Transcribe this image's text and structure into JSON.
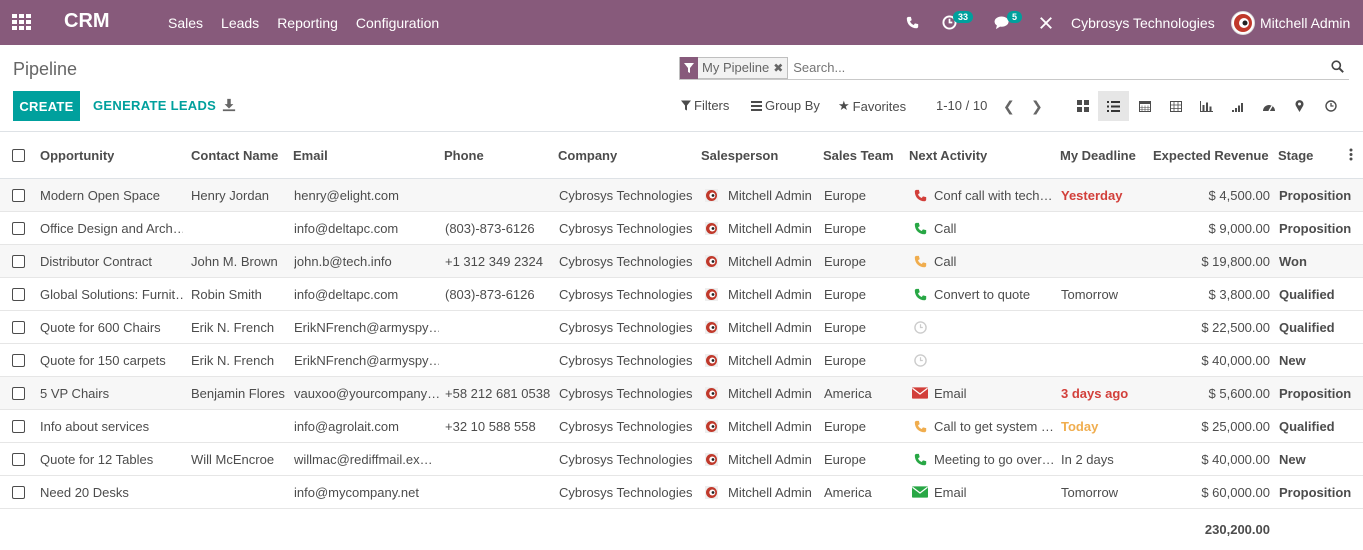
{
  "app": {
    "brand": "CRM",
    "menu": [
      "Sales",
      "Leads",
      "Reporting",
      "Configuration"
    ],
    "activity_count": "33",
    "message_count": "5",
    "company": "Cybrosys Technologies",
    "user": "Mitchell Admin"
  },
  "control": {
    "title": "Pipeline",
    "facet_label": "My Pipeline",
    "search_placeholder": "Search...",
    "create_label": "CREATE",
    "generate_label": "GENERATE LEADS",
    "filters_label": "Filters",
    "groupby_label": "Group By",
    "favorites_label": "Favorites",
    "pager": "1-10 / 10"
  },
  "colors": {
    "navbar": "#875a7b",
    "primary": "#00a09d",
    "danger": "#d23f3a",
    "warning": "#f0ad4e",
    "success": "#28a745",
    "phone_red": "#d23f3a",
    "phone_green": "#28a745",
    "phone_orange": "#f0ad4e"
  },
  "table": {
    "columns": [
      "Opportunity",
      "Contact Name",
      "Email",
      "Phone",
      "Company",
      "Salesperson",
      "Sales Team",
      "Next Activity",
      "My Deadline",
      "Expected Revenue",
      "Stage"
    ],
    "rows": [
      {
        "opportunity": "Modern Open Space",
        "contact": "Henry Jordan",
        "email": "henry@elight.com",
        "phone": "",
        "company": "Cybrosys Technologies",
        "salesperson": "Mitchell Admin",
        "team": "Europe",
        "activity": "Conf call with tech…",
        "activity_icon": "phone-icon",
        "activity_color": "#d23f3a",
        "deadline": "Yesterday",
        "deadline_style": "red",
        "revenue": "$ 4,500.00",
        "stage": "Proposition"
      },
      {
        "opportunity": "Office Design and Arch…",
        "contact": "",
        "email": "info@deltapc.com",
        "phone": "(803)-873-6126",
        "company": "Cybrosys Technologies",
        "salesperson": "Mitchell Admin",
        "team": "Europe",
        "activity": "Call",
        "activity_icon": "phone-icon",
        "activity_color": "#28a745",
        "deadline": "",
        "deadline_style": "",
        "revenue": "$ 9,000.00",
        "stage": "Proposition"
      },
      {
        "opportunity": "Distributor Contract",
        "contact": "John M. Brown",
        "email": "john.b@tech.info",
        "phone": "+1 312 349 2324",
        "company": "Cybrosys Technologies",
        "salesperson": "Mitchell Admin",
        "team": "Europe",
        "activity": "Call",
        "activity_icon": "phone-icon",
        "activity_color": "#f0ad4e",
        "deadline": "",
        "deadline_style": "",
        "revenue": "$ 19,800.00",
        "stage": "Won"
      },
      {
        "opportunity": "Global Solutions: Furnit…",
        "contact": "Robin Smith",
        "email": "info@deltapc.com",
        "phone": "(803)-873-6126",
        "company": "Cybrosys Technologies",
        "salesperson": "Mitchell Admin",
        "team": "Europe",
        "activity": "Convert to quote",
        "activity_icon": "phone-icon",
        "activity_color": "#28a745",
        "deadline": "Tomorrow",
        "deadline_style": "",
        "revenue": "$ 3,800.00",
        "stage": "Qualified"
      },
      {
        "opportunity": "Quote for 600 Chairs",
        "contact": "Erik N. French",
        "email": "ErikNFrench@armyspy…",
        "phone": "",
        "company": "Cybrosys Technologies",
        "salesperson": "Mitchell Admin",
        "team": "Europe",
        "activity": "",
        "activity_icon": "clock-icon",
        "activity_color": "#cccccc",
        "deadline": "",
        "deadline_style": "",
        "revenue": "$ 22,500.00",
        "stage": "Qualified"
      },
      {
        "opportunity": "Quote for 150 carpets",
        "contact": "Erik N. French",
        "email": "ErikNFrench@armyspy…",
        "phone": "",
        "company": "Cybrosys Technologies",
        "salesperson": "Mitchell Admin",
        "team": "Europe",
        "activity": "",
        "activity_icon": "clock-icon",
        "activity_color": "#cccccc",
        "deadline": "",
        "deadline_style": "",
        "revenue": "$ 40,000.00",
        "stage": "New"
      },
      {
        "opportunity": "5 VP Chairs",
        "contact": "Benjamin Flores",
        "email": "vauxoo@yourcompany…",
        "phone": "+58 212 681 0538",
        "company": "Cybrosys Technologies",
        "salesperson": "Mitchell Admin",
        "team": "America",
        "activity": "Email",
        "activity_icon": "envelope-icon",
        "activity_color": "#d23f3a",
        "deadline": "3 days ago",
        "deadline_style": "red",
        "revenue": "$ 5,600.00",
        "stage": "Proposition"
      },
      {
        "opportunity": "Info about services",
        "contact": "",
        "email": "info@agrolait.com",
        "phone": "+32 10 588 558",
        "company": "Cybrosys Technologies",
        "salesperson": "Mitchell Admin",
        "team": "Europe",
        "activity": "Call to get system …",
        "activity_icon": "phone-icon",
        "activity_color": "#f0ad4e",
        "deadline": "Today",
        "deadline_style": "orange",
        "revenue": "$ 25,000.00",
        "stage": "Qualified"
      },
      {
        "opportunity": "Quote for 12 Tables",
        "contact": "Will McEncroe",
        "email": "willmac@rediffmail.ex…",
        "phone": "",
        "company": "Cybrosys Technologies",
        "salesperson": "Mitchell Admin",
        "team": "Europe",
        "activity": "Meeting to go over…",
        "activity_icon": "phone-icon",
        "activity_color": "#28a745",
        "deadline": "In 2 days",
        "deadline_style": "",
        "revenue": "$ 40,000.00",
        "stage": "New"
      },
      {
        "opportunity": "Need 20 Desks",
        "contact": "",
        "email": "info@mycompany.net",
        "phone": "",
        "company": "Cybrosys Technologies",
        "salesperson": "Mitchell Admin",
        "team": "America",
        "activity": "Email",
        "activity_icon": "envelope-icon",
        "activity_color": "#28a745",
        "deadline": "Tomorrow",
        "deadline_style": "",
        "revenue": "$ 60,000.00",
        "stage": "Proposition"
      }
    ],
    "total_revenue": "230,200.00"
  }
}
